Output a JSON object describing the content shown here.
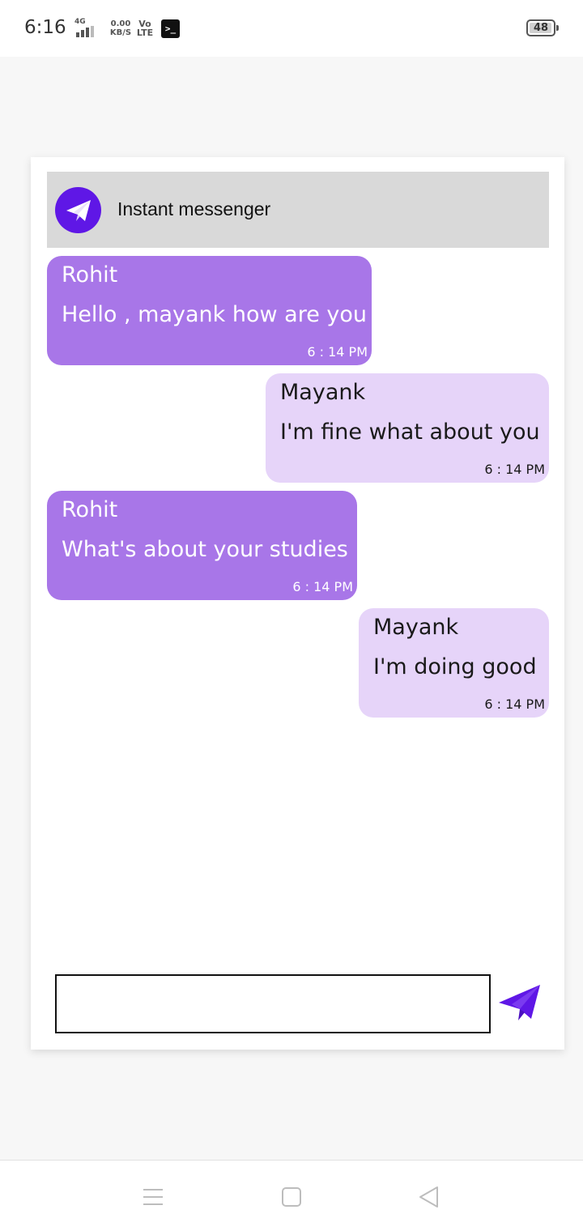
{
  "status_bar": {
    "time": "6:16",
    "network": "4G",
    "speed_value": "0.00",
    "speed_unit": "KB/S",
    "volte_top": "Vo",
    "volte_bottom": "LTE",
    "terminal_glyph": ">_",
    "battery": "48"
  },
  "app": {
    "title": "Instant messenger",
    "logo_icon": "paper-plane-icon",
    "accent_color": "#5f17e6",
    "incoming_color": "#a876e8",
    "outgoing_color": "#e6d4f9"
  },
  "messages": [
    {
      "sender": "Rohit",
      "text": "Hello , mayank how are you",
      "time": "6 : 14 PM",
      "direction": "incoming"
    },
    {
      "sender": "Mayank",
      "text": "I'm fine what about you",
      "time": "6 : 14 PM",
      "direction": "outgoing"
    },
    {
      "sender": "Rohit",
      "text": "What's about your studies",
      "time": "6 : 14 PM",
      "direction": "incoming"
    },
    {
      "sender": "Mayank",
      "text": "I'm doing good",
      "time": "6 : 14 PM",
      "direction": "outgoing"
    }
  ],
  "composer": {
    "value": "",
    "placeholder": "",
    "send_icon": "send-icon"
  },
  "nav": {
    "menu_icon": "menu-icon",
    "home_icon": "home-icon",
    "back_icon": "back-icon"
  }
}
